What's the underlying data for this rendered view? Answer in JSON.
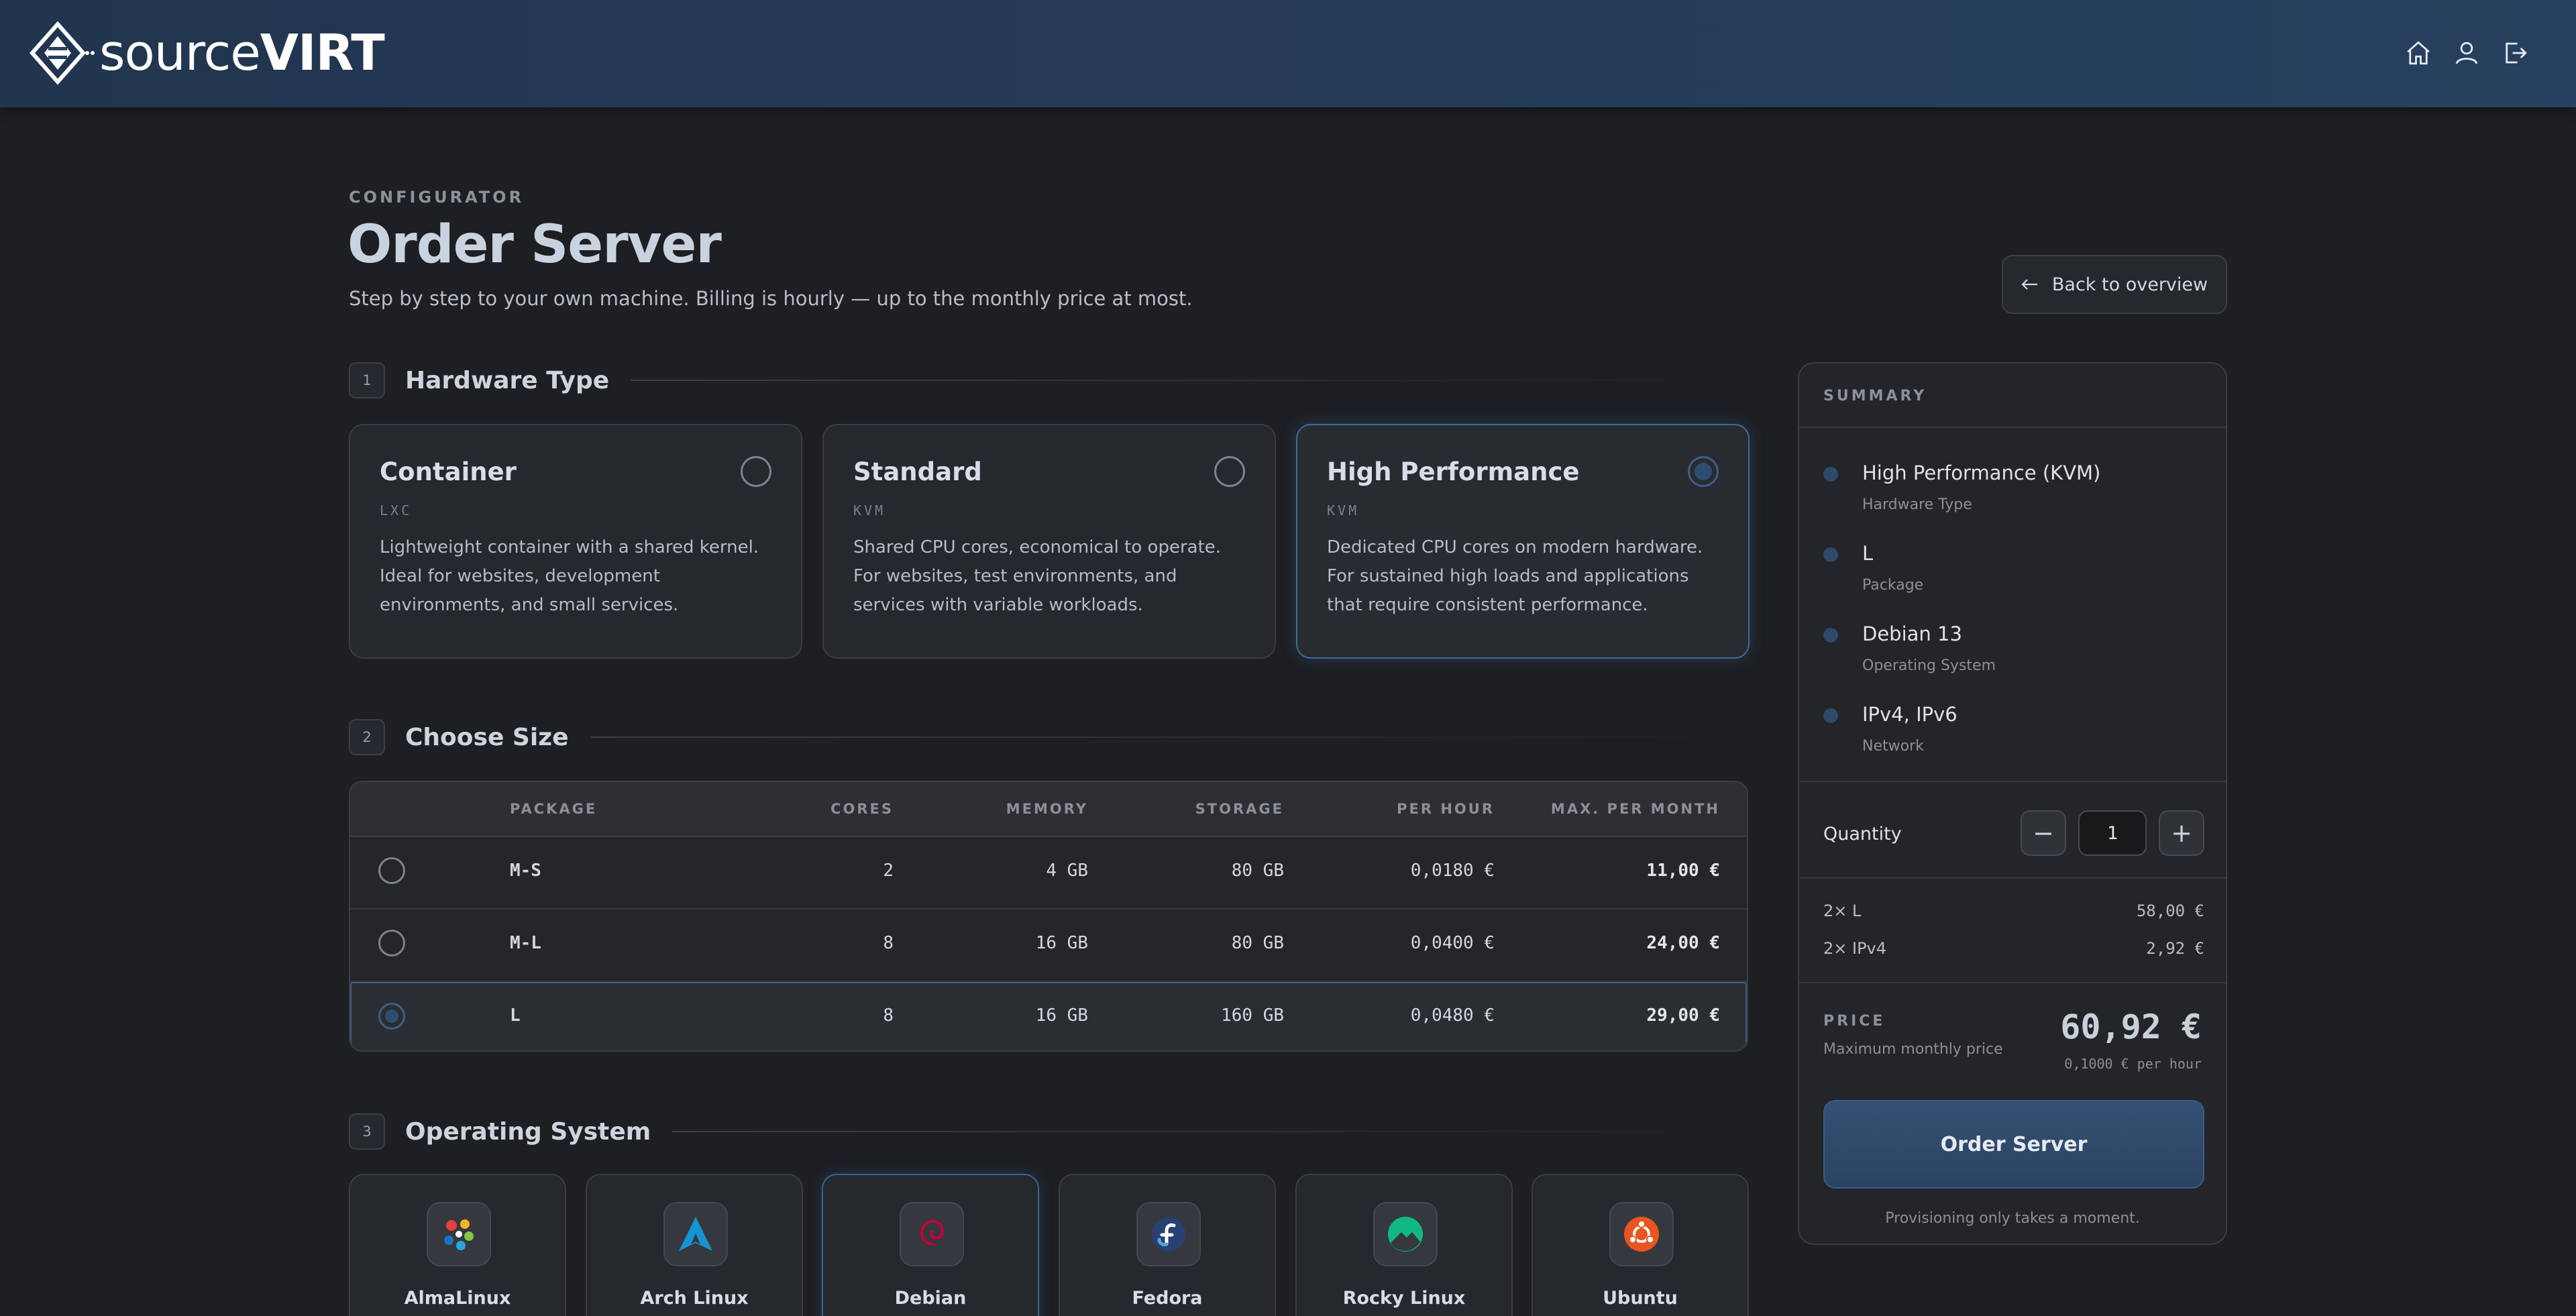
{
  "header": {
    "brand_prefix": "source",
    "brand_suffix": "VIRT",
    "icons": [
      "home-icon",
      "user-icon",
      "logout-icon"
    ]
  },
  "page": {
    "eyebrow": "CONFIGURATOR",
    "title": "Order Server",
    "subtitle": "Step by step to your own machine. Billing is hourly — up to the monthly price at most.",
    "back_label": "Back to overview"
  },
  "sections": {
    "hardware": {
      "num": "1",
      "title": "Hardware Type"
    },
    "size": {
      "num": "2",
      "title": "Choose Size"
    },
    "os": {
      "num": "3",
      "title": "Operating System"
    }
  },
  "hardware_types": [
    {
      "name": "Container",
      "tag": "LXC",
      "desc": "Lightweight container with a shared kernel. Ideal for websites, development environments, and small services.",
      "selected": false
    },
    {
      "name": "Standard",
      "tag": "KVM",
      "desc": "Shared CPU cores, economical to operate. For websites, test environments, and services with variable workloads.",
      "selected": false
    },
    {
      "name": "High Performance",
      "tag": "KVM",
      "desc": "Dedicated CPU cores on modern hardware. For sustained high loads and applications that require consistent performance.",
      "selected": true
    }
  ],
  "size_table": {
    "columns": [
      "PACKAGE",
      "CORES",
      "MEMORY",
      "STORAGE",
      "PER HOUR",
      "MAX. PER MONTH"
    ],
    "rows": [
      {
        "package": "M-S",
        "cores": "2",
        "memory": "4 GB",
        "storage": "80 GB",
        "per_hour": "0,0180 €",
        "max_month": "11,00 €",
        "selected": false
      },
      {
        "package": "M-L",
        "cores": "8",
        "memory": "16 GB",
        "storage": "80 GB",
        "per_hour": "0,0400 €",
        "max_month": "24,00 €",
        "selected": false
      },
      {
        "package": "L",
        "cores": "8",
        "memory": "16 GB",
        "storage": "160 GB",
        "per_hour": "0,0480 €",
        "max_month": "29,00 €",
        "selected": true
      }
    ]
  },
  "operating_systems": [
    {
      "name": "AlmaLinux",
      "icon": "almalinux-icon",
      "selected": false
    },
    {
      "name": "Arch Linux",
      "icon": "archlinux-icon",
      "selected": false
    },
    {
      "name": "Debian",
      "icon": "debian-icon",
      "selected": true
    },
    {
      "name": "Fedora",
      "icon": "fedora-icon",
      "selected": false
    },
    {
      "name": "Rocky Linux",
      "icon": "rockylinux-icon",
      "selected": false
    },
    {
      "name": "Ubuntu",
      "icon": "ubuntu-icon",
      "selected": false
    }
  ],
  "summary": {
    "heading": "SUMMARY",
    "items": [
      {
        "value": "High Performance (KVM)",
        "label": "Hardware Type"
      },
      {
        "value": "L",
        "label": "Package"
      },
      {
        "value": "Debian 13",
        "label": "Operating System"
      },
      {
        "value": "IPv4, IPv6",
        "label": "Network"
      }
    ],
    "quantity_label": "Quantity",
    "quantity": "1",
    "minus": "−",
    "plus": "+",
    "lines": [
      {
        "label": "2× L",
        "amount": "58,00 €"
      },
      {
        "label": "2× IPv4",
        "amount": "2,92 €"
      }
    ],
    "price_label": "PRICE",
    "price_sub": "Maximum monthly price",
    "price": "60,92 €",
    "per_hour": "0,1000 € per hour",
    "order_label": "Order Server",
    "note": "Provisioning only takes a moment."
  },
  "colors": {
    "accent": "#2e4d72",
    "header_bg": "#22354f",
    "page_bg": "#1d1f23"
  }
}
